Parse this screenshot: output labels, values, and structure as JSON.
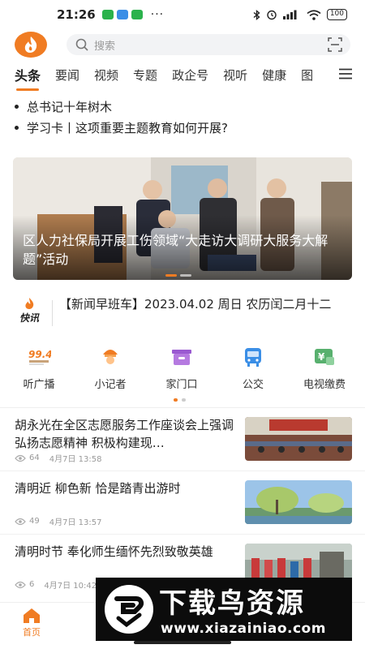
{
  "status_bar": {
    "time": "21:26",
    "dots": "···",
    "battery": "100"
  },
  "header": {
    "logo_icon": "flame-logo-icon",
    "search_placeholder": "搜索"
  },
  "tabs": [
    "头条",
    "要闻",
    "视频",
    "专题",
    "政企号",
    "视听",
    "健康",
    "图"
  ],
  "active_tab": "头条",
  "headlines": [
    "总书记十年树木",
    "学习卡丨这项重要主题教育如何开展?"
  ],
  "banner": {
    "title": "区人力社保局开展工伤领域“大走访大调研大服务大解题”活动"
  },
  "kuaixun": {
    "label": "快讯",
    "text": "【新闻早班车】2023.04.02 周日 农历闰二月十二"
  },
  "services": [
    {
      "label": "听广播",
      "icon": "radio-icon"
    },
    {
      "label": "小记者",
      "icon": "reporter-icon"
    },
    {
      "label": "家门口",
      "icon": "doorstep-icon"
    },
    {
      "label": "公交",
      "icon": "bus-icon"
    },
    {
      "label": "电视缴费",
      "icon": "tv-payment-icon"
    }
  ],
  "news": [
    {
      "title": "胡永光在全区志愿服务工作座谈会上强调 弘扬志愿精神 积极构建现…",
      "views": "64",
      "date": "4月7日 13:58"
    },
    {
      "title": "清明近 柳色新 恰是踏青出游时",
      "views": "49",
      "date": "4月7日 13:57"
    },
    {
      "title": "清明时节 奉化师生缅怀先烈致敬英雄",
      "views": "6",
      "date": "4月7日 10:42"
    }
  ],
  "bottom_nav": {
    "home_label": "首页"
  },
  "watermark": {
    "title": "下载鸟资源",
    "url": "www.xiazainiao.com"
  },
  "colors": {
    "accent": "#f07c23",
    "text": "#222222",
    "muted": "#999999"
  }
}
